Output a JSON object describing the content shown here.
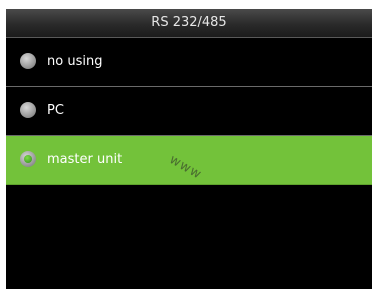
{
  "header": {
    "title": "RS 232/485"
  },
  "options": [
    {
      "label": "no using",
      "selected": false
    },
    {
      "label": "PC",
      "selected": false
    },
    {
      "label": "master unit",
      "selected": true
    }
  ],
  "watermark": "www",
  "colors": {
    "screen_bg": "#000000",
    "selected_bg": "#73c23a",
    "text": "#ffffff"
  },
  "icons": {
    "radio": "radio-button-icon"
  }
}
